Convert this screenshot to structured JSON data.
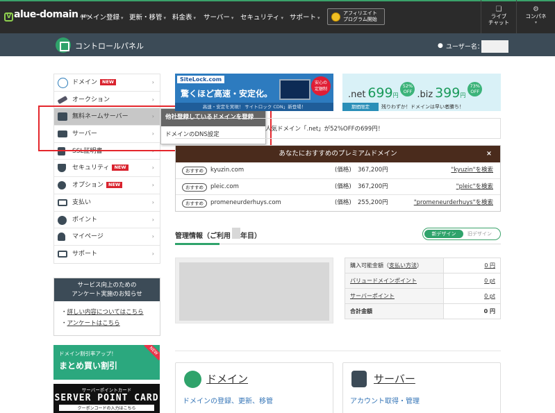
{
  "header": {
    "logo_text": "alue-domain",
    "logo_v": "V",
    "logo_suffix": ".com",
    "nav": [
      {
        "label": "ドメイン登録"
      },
      {
        "label": "更新・移管"
      },
      {
        "label": "料金表"
      },
      {
        "label": "サーバー"
      },
      {
        "label": "セキュリティ"
      },
      {
        "label": "サポート"
      }
    ],
    "affiliate_line1": "アフィリエイト",
    "affiliate_line2": "プログラム開始",
    "live_chat_line1": "ライブ",
    "live_chat_line2": "チャット",
    "panel_label": "コンパネ",
    "icons": {
      "chat": "chat-icon",
      "gear": "gear-icon"
    }
  },
  "subbar": {
    "title": "コントロールパネル",
    "user_label": "ユーザー名："
  },
  "sidebar": {
    "items": [
      {
        "label": "ドメイン",
        "new": "NEW",
        "icon": "com-icon"
      },
      {
        "label": "オークション",
        "icon": "hammer-icon"
      },
      {
        "label": "無料ネームサーバー",
        "icon": "server-stack-icon"
      },
      {
        "label": "サーバー",
        "icon": "server-icon"
      },
      {
        "label": "SSL証明書",
        "icon": "lock-icon"
      },
      {
        "label": "セキュリティ",
        "new": "NEW",
        "icon": "shield-icon"
      },
      {
        "label": "オプション",
        "new": "NEW",
        "icon": "gears-icon"
      },
      {
        "label": "支払い",
        "icon": "card-icon"
      },
      {
        "label": "ポイント",
        "icon": "coin-icon"
      },
      {
        "label": "マイページ",
        "icon": "user-icon"
      },
      {
        "label": "サポート",
        "icon": "mail-icon"
      }
    ],
    "flyout": [
      {
        "label": "他社登録しているドメインを登録"
      },
      {
        "label": "ドメインのDNS設定"
      }
    ],
    "arrow": "›",
    "survey": {
      "title_line1": "サービス向上のための",
      "title_line2": "アンケート実施のお知らせ",
      "links": [
        "詳しい内容についてはこちら",
        "アンケートはこちら"
      ]
    },
    "promo_bulk": {
      "small": "ドメイン割引率アップ！",
      "big": "まとめ買い割引",
      "badge": "NEW"
    },
    "promo_points": {
      "small": "サーバーポイントカード",
      "big": "SERVER POINT CARD",
      "tail": "クーポンコードの入力はこちら"
    }
  },
  "banners": {
    "sitelock": {
      "logo": "SiteLock.com",
      "headline": "驚くほど高速・安定化。",
      "badge_line1": "安心の",
      "badge_line2": "定額制",
      "footer": "高速・安定を実現！ サイトロック CDN」新登場！"
    },
    "sale": {
      "net": ".net",
      "net_price": "699",
      "net_off": "52%",
      "biz": ".biz",
      "biz_price": "399",
      "biz_off": "73%",
      "yen": "円",
      "off_word": "OFF",
      "tag": "期間限定",
      "footer": "残りわずか！ドメインは早い者勝ち！"
    }
  },
  "news": {
    "text": "人気ドメイン「.net」が52%OFFの699円！"
  },
  "premium": {
    "title": "あなたにおすすめのプレミアムドメイン",
    "close": "×",
    "rows": [
      {
        "tag": "おすすめ",
        "domain": "kyuzin.com",
        "price_label": "(価格)",
        "price": "367,200円",
        "link": "\"kyuzin\"を検索"
      },
      {
        "tag": "おすすめ",
        "domain": "pleic.com",
        "price_label": "(価格)",
        "price": "367,200円",
        "link": "\"pleic\"を検索"
      },
      {
        "tag": "おすすめ",
        "domain": "promeneurderhuys.com",
        "price_label": "(価格)",
        "price": "255,200円",
        "link": "\"promeneurderhuys\"を検索"
      }
    ]
  },
  "management": {
    "title_prefix": "管理情報（ご利用",
    "title_suffix": "年目）",
    "toggle_new": "新デザイン",
    "toggle_old": "旧デザイン"
  },
  "balance": {
    "rows": [
      {
        "label": "購入可能金額（",
        "label_link": "支払い方法",
        "label_tail": "）",
        "value": "0 円"
      },
      {
        "label": "",
        "label_link": "バリュードメインポイント",
        "label_tail": "",
        "value": "0 pt"
      },
      {
        "label": "",
        "label_link": "サーバーポイント",
        "label_tail": "",
        "value": "0 pt"
      },
      {
        "label": "合計金額",
        "label_link": "",
        "label_tail": "",
        "value": "0 円"
      }
    ]
  },
  "cards": [
    {
      "title": "ドメイン",
      "sub": "ドメインの登録、更新、移管",
      "icon": "com-icon"
    },
    {
      "title": "サーバー",
      "sub": "アカウント取得・管理",
      "icon": "server-icon"
    }
  ],
  "colors": {
    "accent": "#2fa36b",
    "header": "#2b2b2b",
    "subbar": "#3c4b57",
    "new_badge": "#d9232e",
    "highlight_box": "#e4262c"
  }
}
